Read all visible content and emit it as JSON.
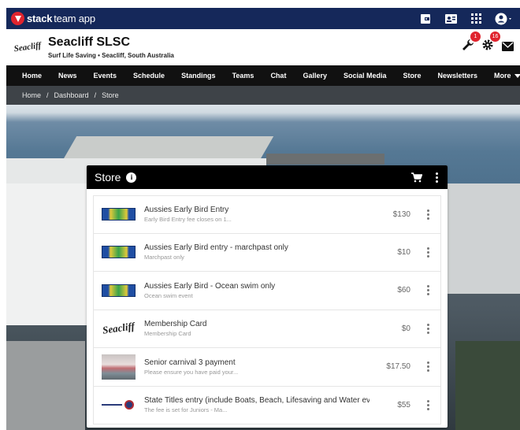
{
  "brand": {
    "bold": "stack",
    "light": "team app"
  },
  "club": {
    "name": "Seacliff SLSC",
    "subtitle": "Surf Life Saving • Seacliff, South Australia",
    "logo_text": "Seacliff"
  },
  "header_icons": [
    {
      "icon": "wrench-icon",
      "badge": "1"
    },
    {
      "icon": "gear-icon",
      "badge": "16"
    },
    {
      "icon": "mail-icon",
      "badge": ""
    }
  ],
  "nav": {
    "items": [
      "Home",
      "News",
      "Events",
      "Schedule",
      "Standings",
      "Teams",
      "Chat",
      "Gallery",
      "Social Media",
      "Store",
      "Newsletters"
    ],
    "more": "More"
  },
  "breadcrumb": [
    "Home",
    "Dashboard",
    "Store"
  ],
  "store": {
    "title": "Store",
    "products": [
      {
        "name": "Aussies Early Bird Entry",
        "desc": "Early Bird Entry fee closes on 1...",
        "price": "$130",
        "thumb": "flag"
      },
      {
        "name": "Aussies Early Bird entry - marchpast only",
        "desc": "Marchpast only",
        "price": "$10",
        "thumb": "flag"
      },
      {
        "name": "Aussies Early Bird - Ocean swim only",
        "desc": "Ocean swim event",
        "price": "$60",
        "thumb": "flag"
      },
      {
        "name": "Membership Card",
        "desc": "Membership Card",
        "price": "$0",
        "thumb": "logo"
      },
      {
        "name": "Senior carnival 3 payment",
        "desc": "Please ensure you have paid your...",
        "price": "$17.50",
        "thumb": "photo"
      },
      {
        "name": "State Titles entry (include Boats, Beach, Lifesaving and Water events)",
        "desc": "The fee is set for Juniors - Ma...",
        "price": "$55",
        "thumb": "sa"
      }
    ]
  },
  "colors": {
    "topbar": "#15285a",
    "accent": "#e0242e",
    "nav": "#111111",
    "breadcrumb": "#3e4348"
  }
}
